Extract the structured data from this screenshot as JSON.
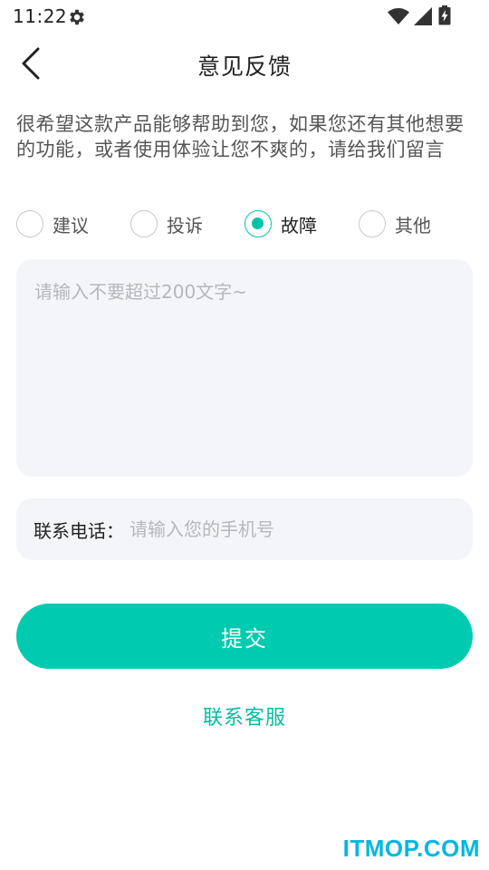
{
  "status_bar": {
    "time": "11:22",
    "icons": [
      "gear-icon",
      "wifi-icon",
      "cellular-signal-icon",
      "battery-charging-icon"
    ]
  },
  "header": {
    "title": "意见反馈",
    "back_icon": "chevron-left-icon"
  },
  "intro": {
    "text": "很希望这款产品能够帮助到您，如果您还有其他想要的功能，或者使用体验让您不爽的，请给我们留言"
  },
  "feedback_types": {
    "options": [
      {
        "label": "建议",
        "selected": false
      },
      {
        "label": "投诉",
        "selected": false
      },
      {
        "label": "故障",
        "selected": true
      },
      {
        "label": "其他",
        "selected": false
      }
    ]
  },
  "feedback": {
    "value": "",
    "placeholder": "请输入不要超过200文字~"
  },
  "phone": {
    "label": "联系电话：",
    "value": "",
    "placeholder": "请输入您的手机号"
  },
  "actions": {
    "submit_label": "提交",
    "contact_label": "联系客服"
  },
  "watermark": {
    "text": "ITMOP.COM"
  },
  "colors": {
    "accent": "#00cbb0",
    "link": "#00bfa3",
    "input_bg": "#f4f5f9",
    "watermark": "#00b8e0"
  }
}
